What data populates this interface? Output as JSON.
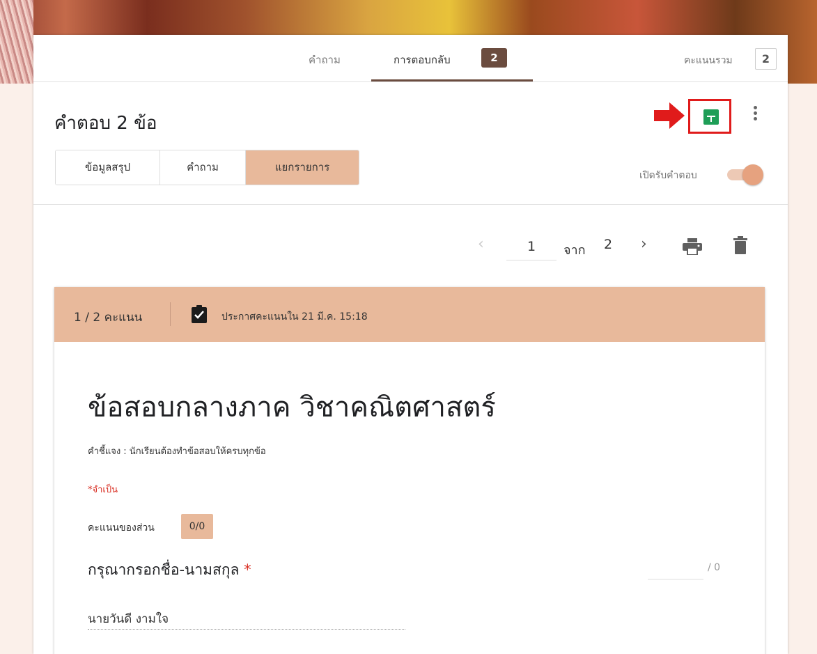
{
  "tabs": {
    "questions": "คำถาม",
    "responses": "การตอบกลับ",
    "responses_count": "2",
    "total_label": "คะแนนรวม",
    "total_value": "2"
  },
  "header": {
    "title": "คำตอบ 2 ข้อ",
    "segments": [
      "ข้อมูลสรุป",
      "คำถาม",
      "แยกรายการ"
    ],
    "accept_label": "เปิดรับคำตอบ",
    "accepting": true
  },
  "pager": {
    "current": "1",
    "of": "จาก",
    "total": "2"
  },
  "response": {
    "score": "1 / 2 คะแนน",
    "released": "ประกาศคะแนนใน 21 มี.ค. 15:18",
    "form_title": "ข้อสอบกลางภาค วิชาคณิตศาสตร์",
    "description": "คำชี้แจง : นักเรียนต้องทำข้อสอบให้ครบทุกข้อ",
    "required_note": "*จำเป็น",
    "section_label": "คะแนนของส่วน",
    "section_score": "0/0",
    "question": "กรุณากรอกชื่อ-นามสกุล",
    "question_star": "*",
    "question_max": "/ 0",
    "answer": "นายวันดี งามใจ"
  },
  "icons": {
    "sheets": "sheets-icon",
    "more": "more-vert-icon",
    "prev": "chevron-left-icon",
    "next": "chevron-right-icon",
    "print": "print-icon",
    "delete": "trash-icon",
    "released": "clipboard-check-icon",
    "arrow": "red-arrow-annotation"
  },
  "colors": {
    "accent": "#6b4c3f",
    "theme": "#e8b99b",
    "sheets": "#1e9e57",
    "annotation": "#e01b1b"
  }
}
